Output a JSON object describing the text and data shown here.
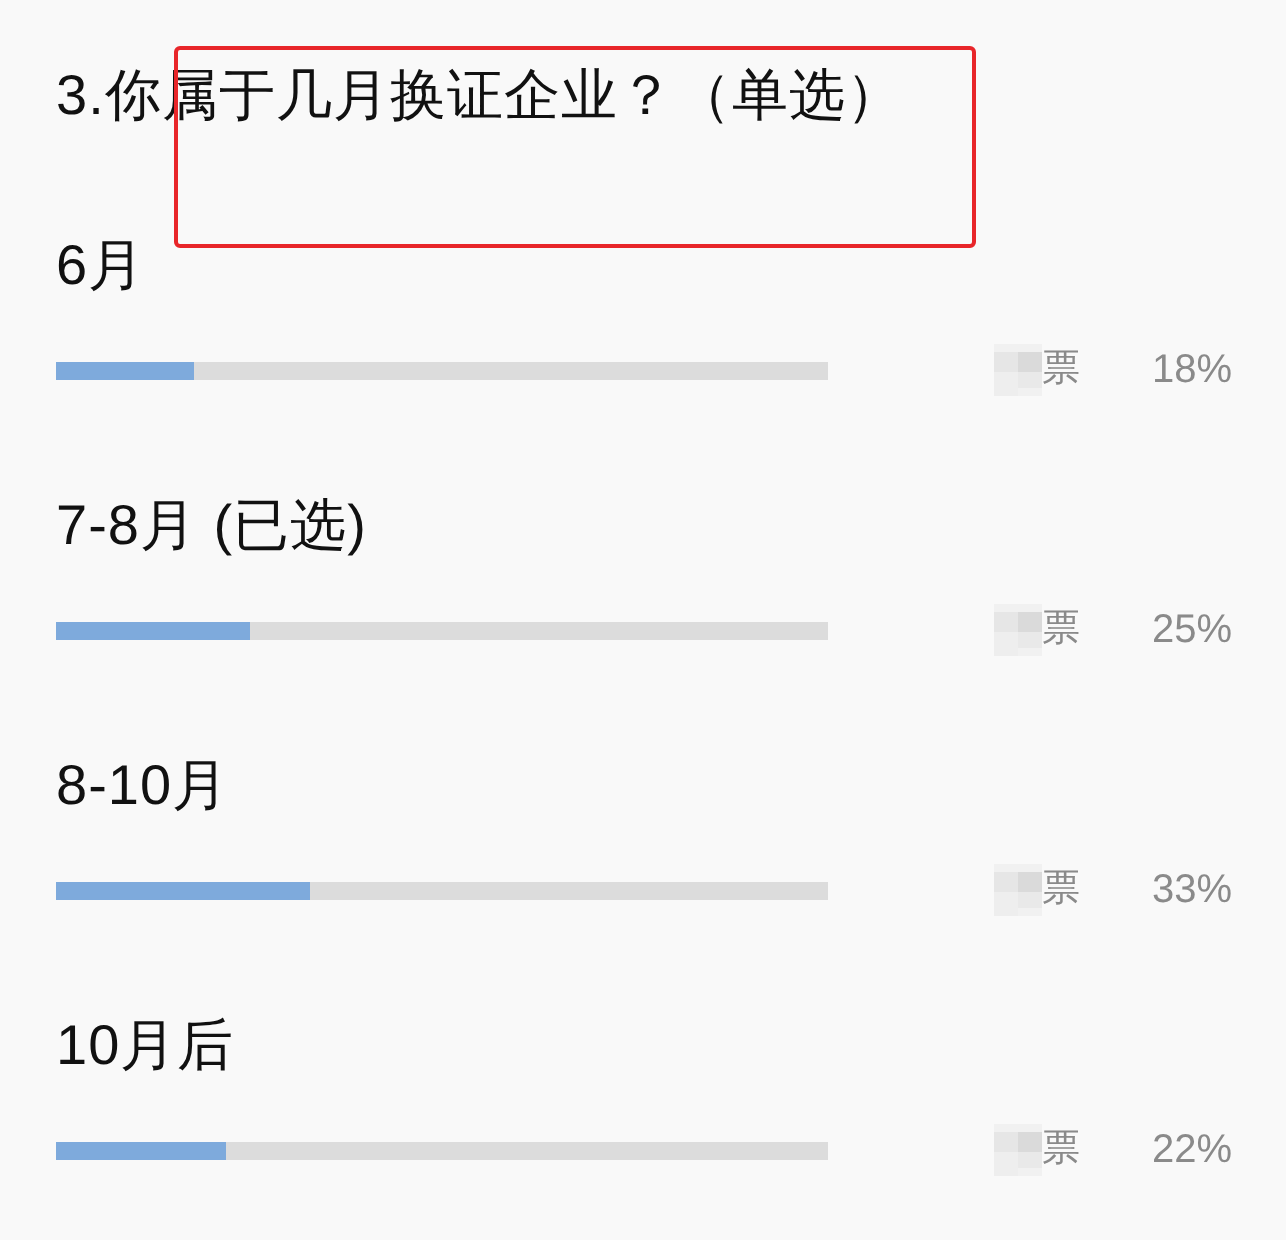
{
  "question": {
    "title": "3.你属于几月换证企业？（单选）"
  },
  "options": [
    {
      "label": "6月",
      "level": 0.18,
      "votes_unit": "票",
      "percent": "18%"
    },
    {
      "label": "7-8月 (已选)",
      "level": 0.25,
      "votes_unit": "票",
      "percent": "25%"
    },
    {
      "label": "8-10月",
      "level": 0.33,
      "votes_unit": "票",
      "percent": "33%"
    },
    {
      "label": "10月后",
      "level": 0.22,
      "votes_unit": "票",
      "percent": "22%"
    }
  ]
}
